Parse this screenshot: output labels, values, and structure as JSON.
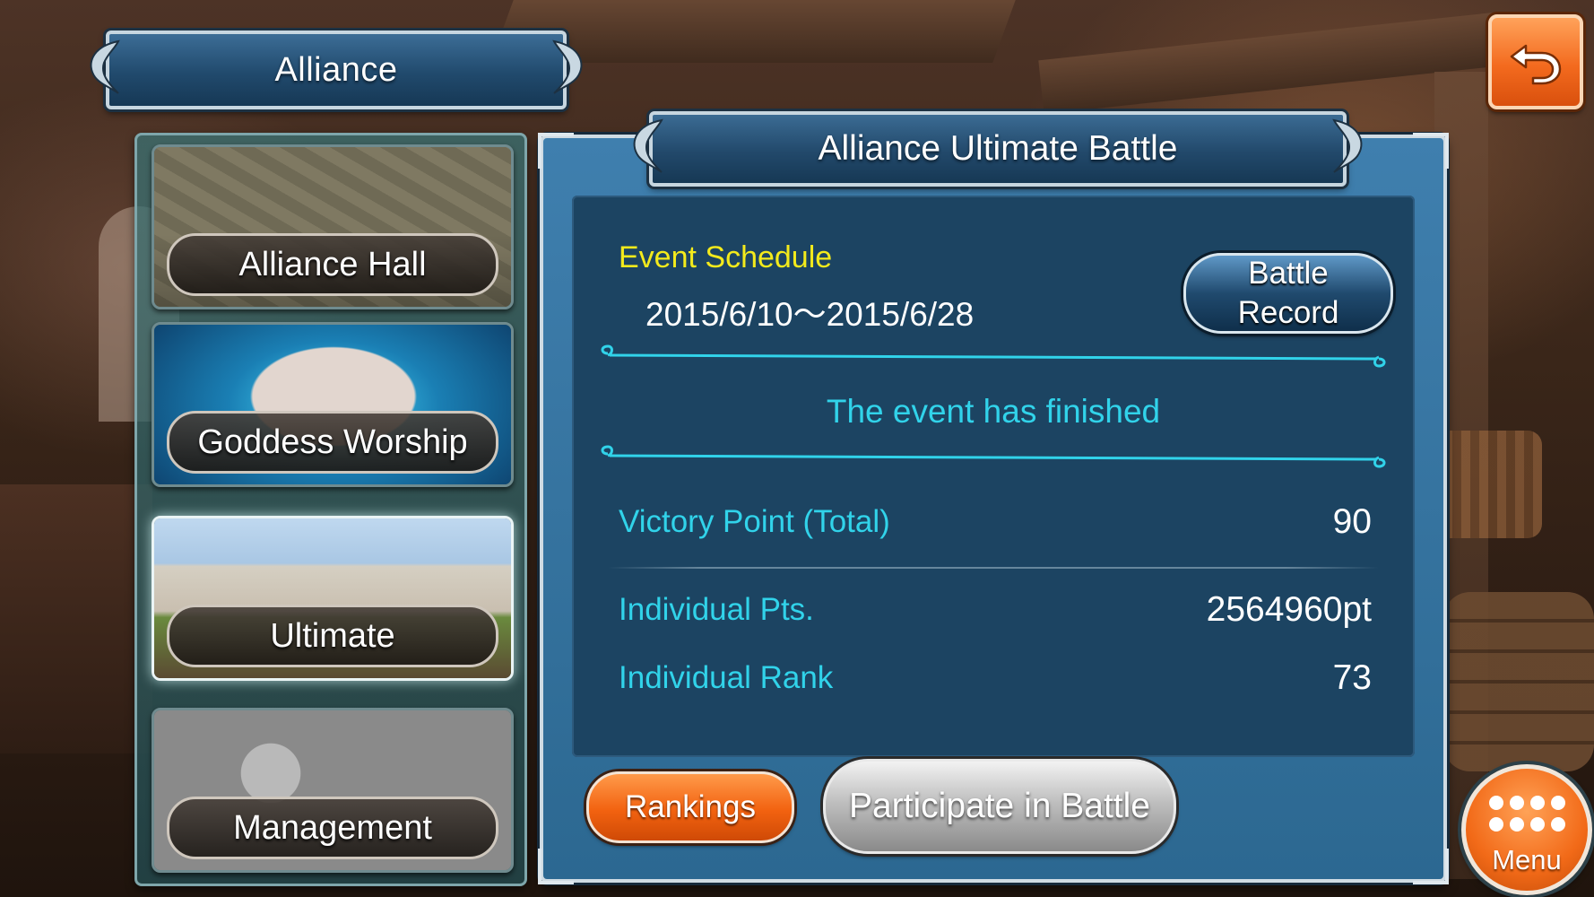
{
  "header": {
    "title": "Alliance"
  },
  "back_button": {
    "icon": "return-arrow-icon"
  },
  "sidebar": {
    "items": [
      {
        "label": "Alliance Hall",
        "selected": false
      },
      {
        "label": "Goddess Worship",
        "selected": false
      },
      {
        "label": "Ultimate",
        "selected": true
      },
      {
        "label": "Management",
        "selected": false
      }
    ]
  },
  "panel": {
    "title": "Alliance Ultimate Battle",
    "schedule_label": "Event Schedule",
    "schedule_value": "2015/6/10～2015/6/28",
    "battle_record_label": "Battle Record",
    "status_text": "The event has finished",
    "stats": [
      {
        "label": "Victory Point (Total)",
        "value": "90"
      },
      {
        "label": "Individual Pts.",
        "value": "2564960pt"
      },
      {
        "label": "Individual Rank",
        "value": "73"
      }
    ],
    "rankings_label": "Rankings",
    "participate_label": "Participate in Battle"
  },
  "menu_button": {
    "label": "Menu",
    "icon": "dots-grid-icon"
  },
  "colors": {
    "accent_cyan": "#31d3ea",
    "schedule_yellow": "#f3ea1c",
    "orange_button": "#f26210",
    "panel_blue": "#2c6891"
  }
}
